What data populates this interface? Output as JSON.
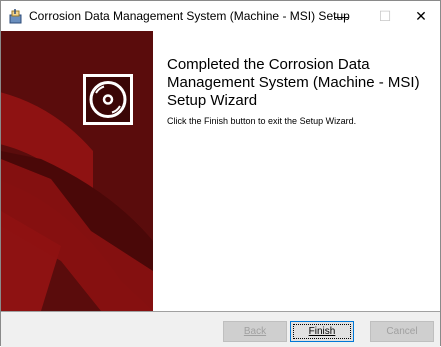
{
  "window": {
    "title": "Corrosion Data Management System (Machine - MSI) Setup",
    "minimize_glyph": "—",
    "maximize_glyph": "☐",
    "close_glyph": "✕"
  },
  "banner": {
    "icon": "cd-disc-icon",
    "colors": {
      "background": "#5a0c0c",
      "accent": "#8e1212",
      "icon_border": "#ffffff"
    }
  },
  "main": {
    "heading": "Completed the Corrosion Data Management System (Machine - MSI) Setup Wizard",
    "description": "Click the Finish button to exit the Setup Wizard."
  },
  "footer": {
    "back_label": "Back",
    "finish_label": "Finish",
    "cancel_label": "Cancel"
  }
}
